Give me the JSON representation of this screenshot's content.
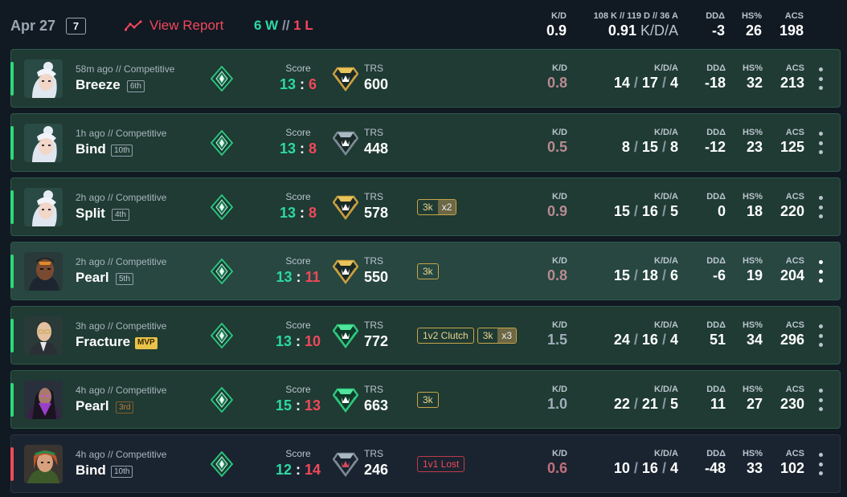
{
  "header": {
    "date": "Apr 27",
    "match_count": "7",
    "view_report": "View Report",
    "wins": "6 W",
    "sep": "//",
    "losses": "1 L",
    "kd_label": "K/D",
    "kd_value": "0.9",
    "kda_label": "108 K // 119 D // 36 A",
    "kda_value": "0.91",
    "kda_unit": "K/D/A",
    "dd_label": "DDΔ",
    "dd_value": "-3",
    "hs_label": "HS%",
    "hs_value": "26",
    "acs_label": "ACS",
    "acs_value": "198"
  },
  "labels": {
    "score": "Score",
    "trs": "TRS",
    "kd": "K/D",
    "kda": "K/D/A",
    "dd": "DDΔ",
    "hs": "HS%",
    "acs": "ACS"
  },
  "colors": {
    "win": "#2ed8a3",
    "loss": "#f0485a",
    "row_win_bg": "#1f3b33",
    "row_loss_bg": "#1a2430",
    "page_bg": "#111923"
  },
  "matches": [
    {
      "time": "58m ago // Competitive",
      "map": "Breeze",
      "place": "6th",
      "agent_icon": "agent-jett-icon",
      "score_us": "13",
      "score_them": "6",
      "score_sep": ":",
      "trs_tier": "gold",
      "trs": "600",
      "badges": [],
      "kd": "0.8",
      "k": "14",
      "d": "17",
      "a": "4",
      "dd": "-18",
      "hs": "32",
      "acs": "213",
      "result": "win"
    },
    {
      "time": "1h ago // Competitive",
      "map": "Bind",
      "place": "10th",
      "agent_icon": "agent-jett-icon",
      "score_us": "13",
      "score_them": "8",
      "score_sep": ":",
      "trs_tier": "silver",
      "trs": "448",
      "badges": [],
      "kd": "0.5",
      "k": "8",
      "d": "15",
      "a": "8",
      "dd": "-12",
      "hs": "23",
      "acs": "125",
      "result": "win"
    },
    {
      "time": "2h ago // Competitive",
      "map": "Split",
      "place": "4th",
      "agent_icon": "agent-jett-icon",
      "score_us": "13",
      "score_them": "8",
      "score_sep": ":",
      "trs_tier": "gold",
      "trs": "578",
      "badges": [
        {
          "text": "3k",
          "mult": "x2"
        }
      ],
      "kd": "0.9",
      "k": "15",
      "d": "16",
      "a": "5",
      "dd": "0",
      "hs": "18",
      "acs": "220",
      "result": "win"
    },
    {
      "time": "2h ago // Competitive",
      "map": "Pearl",
      "place": "5th",
      "agent_icon": "agent-phoenix-icon",
      "score_us": "13",
      "score_them": "11",
      "score_sep": ":",
      "trs_tier": "gold",
      "trs": "550",
      "badges": [
        {
          "text": "3k",
          "mult": ""
        }
      ],
      "kd": "0.8",
      "k": "15",
      "d": "18",
      "a": "6",
      "dd": "-6",
      "hs": "19",
      "acs": "204",
      "result": "win"
    },
    {
      "time": "3h ago // Competitive",
      "map": "Fracture",
      "place": "MVP",
      "agent_icon": "agent-chamber-icon",
      "score_us": "13",
      "score_them": "10",
      "score_sep": ":",
      "trs_tier": "emerald",
      "trs": "772",
      "badges": [
        {
          "text": "1v2 Clutch",
          "mult": ""
        },
        {
          "text": "3k",
          "mult": "x3"
        }
      ],
      "kd": "1.5",
      "k": "24",
      "d": "16",
      "a": "4",
      "dd": "51",
      "hs": "34",
      "acs": "296",
      "result": "win"
    },
    {
      "time": "4h ago // Competitive",
      "map": "Pearl",
      "place": "3rd",
      "agent_icon": "agent-reyna-icon",
      "score_us": "15",
      "score_them": "13",
      "score_sep": ":",
      "trs_tier": "emerald",
      "trs": "663",
      "badges": [
        {
          "text": "3k",
          "mult": ""
        }
      ],
      "kd": "1.0",
      "k": "22",
      "d": "21",
      "a": "5",
      "dd": "11",
      "hs": "27",
      "acs": "230",
      "result": "win"
    },
    {
      "time": "4h ago // Competitive",
      "map": "Bind",
      "place": "10th",
      "agent_icon": "agent-skye-icon",
      "score_us": "12",
      "score_them": "14",
      "score_sep": ":",
      "trs_tier": "silver-red",
      "trs": "246",
      "badges": [
        {
          "text": "1v1 Lost",
          "mult": "",
          "lost": true
        }
      ],
      "kd": "0.6",
      "k": "10",
      "d": "16",
      "a": "4",
      "dd": "-48",
      "hs": "33",
      "acs": "102",
      "result": "loss"
    }
  ]
}
